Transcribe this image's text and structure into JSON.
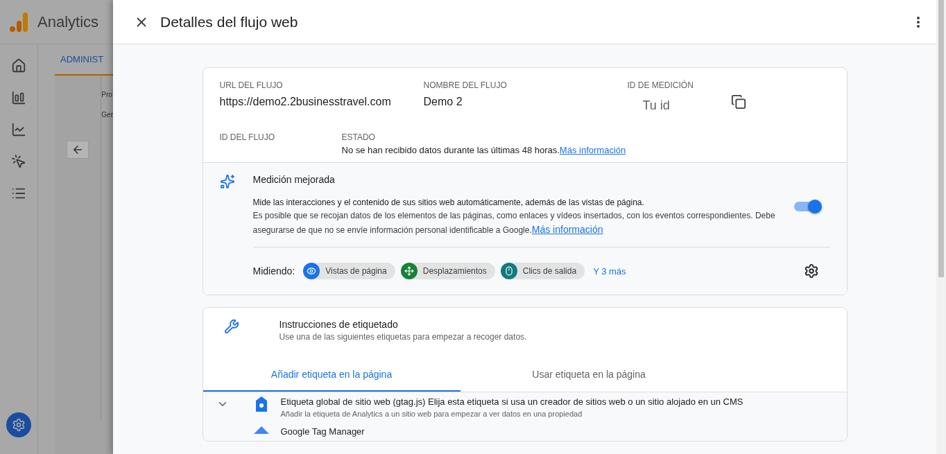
{
  "app": {
    "title": "Analytics",
    "tab": "ADMINIST",
    "crumbs": [
      "Pro",
      "Ger"
    ]
  },
  "panel": {
    "title": "Detalles del flujo web"
  },
  "stream": {
    "fields": [
      {
        "label": "URL DEL FLUJO",
        "value": "https://demo2.2businesstravel.com",
        "kind": "text"
      },
      {
        "label": "NOMBRE DEL FLUJO",
        "value": "Demo 2",
        "kind": "text"
      },
      {
        "label": "ID DE MEDICIÓN",
        "value": "Tu id",
        "kind": "copy"
      }
    ],
    "id_label": "ID DEL FLUJO",
    "status_label": "ESTADO",
    "status_text": "No se han recibido datos durante las últimas 48 horas.",
    "status_link": "Más información"
  },
  "enhanced": {
    "title": "Medición mejorada",
    "lead": "Mide las interacciones y el contenido de sus sitios web automáticamente, además de las vistas de página.",
    "description": "Es posible que se recojan datos de los elementos de las páginas, como enlaces y vídeos insertados, con los eventos correspondientes. Debe asegurarse de que no se envíe información personal identificable a Google.",
    "link": "Más información",
    "on": true,
    "measuring_label": "Midiendo:",
    "events": [
      {
        "label": "Vistas de página",
        "kind": "eye",
        "color": "#1a73e8"
      },
      {
        "label": "Desplazamientos",
        "kind": "scroll",
        "color": "#188038"
      },
      {
        "label": "Clics de salida",
        "kind": "mouse",
        "color": "#137a7f"
      }
    ],
    "more": "Y 3 más"
  },
  "tagging": {
    "title": "Instrucciones de etiquetado",
    "subtitle": "Use una de las siguientes etiquetas para empezar a recoger datos.",
    "tabs": [
      {
        "label": "Añadir etiqueta en la página",
        "selected": true
      },
      {
        "label": "Usar etiqueta en la página",
        "selected": false
      }
    ],
    "options": [
      {
        "title": "Etiqueta global de sitio web (gtag.js) Elija esta etiqueta si usa un creador de sitios web o un sitio alojado en un CMS",
        "subtitle": "Añadir la etiqueta de Analytics a un sitio web para empezar a ver datos en una propiedad",
        "kind": "gtag",
        "expanded": false
      },
      {
        "title": "Google Tag Manager",
        "kind": "gtm"
      }
    ]
  }
}
